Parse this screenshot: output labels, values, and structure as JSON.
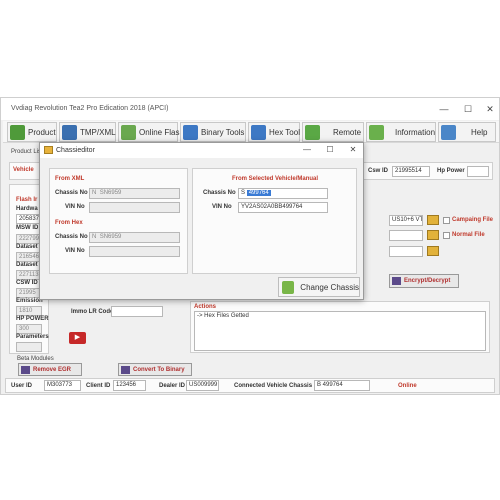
{
  "window": {
    "title": "Vvdiag Revolution Tea2 Pro Edication 2018 (APCI)",
    "minimize_icon": "minimize-icon",
    "maximize_icon": "maximize-icon",
    "close_icon": "close-icon"
  },
  "toolbar": {
    "product": "Product",
    "tmp_xml": "TMP/XML",
    "online_flash": "Online Flash",
    "binary_tools": "Binary Tools",
    "hex_tool": "Hex Tool",
    "remote": "Remote",
    "information": "Information",
    "help": "Help"
  },
  "product_list_label": "Product Lis",
  "vehicle_label": "Vehicle",
  "csw_id": {
    "label": "Csw ID",
    "value": "21995514"
  },
  "hp_power_label": "Hp Power",
  "left_panel": {
    "flash_info": "Flash Ir",
    "hardware_label": "Hardwa",
    "hardware_value": "205837",
    "msw_id_label": "MSW ID",
    "msw_id_value": "222799",
    "dataset_label": "Dataset",
    "dataset_value": "216546",
    "dataset2_label": "Dataset",
    "dataset2_value": "227113",
    "csw_id_label": "CSW ID",
    "csw_id_value": "21995",
    "emission_label": "Emission",
    "emission_value": "1810",
    "hp_power_label": "HP POWER",
    "hp_power_value": "300",
    "parameters_label": "Parameters"
  },
  "right_panel": {
    "vtna_value": "US10+6 VTNA",
    "campaing_file": "Campaing File",
    "normal_file": "Normal File",
    "encrypt_decrypt": "Encrypt/Decrypt"
  },
  "immo_lr_code_label": "Immo LR Code",
  "actions": {
    "title": "Actions",
    "log": "-> Hex Files Getted"
  },
  "beta_modules": {
    "label": "Beta Modules",
    "remove_egr": "Remove EGR",
    "convert_to_binary": "Convert To Binary"
  },
  "status_bar": {
    "user_id_label": "User ID",
    "user_id": "M303773",
    "client_id_label": "Client ID",
    "client_id": "123456",
    "dealer_id_label": "Dealer ID",
    "dealer_id": "US009999",
    "connected_label": "Connected Vehicle Chassis ID",
    "connected_value": "B 499764",
    "status": "Online"
  },
  "dialog": {
    "title": "Chassieditor",
    "from_xml_title": "From XML",
    "xml_chassis_label": "Chassis No",
    "xml_chassis_prefix": "N",
    "xml_chassis_value": "SN6959",
    "xml_vin_label": "VIN No",
    "from_hex_title": "From Hex",
    "hex_chassis_label": "Chassis No",
    "hex_chassis_prefix": "N",
    "hex_chassis_value": "SN6959",
    "hex_vin_label": "VIN No",
    "selected_title": "From Selected Vehicle/Manual",
    "sel_chassis_label": "Chassis No",
    "sel_chassis_prefix": "S",
    "sel_chassis_value": "499764",
    "sel_vin_label": "VIN No",
    "sel_vin_value": "YV2AS02A0BB499764",
    "change_chassis": "Change Chassis"
  },
  "colors": {
    "accent_red": "#c0392b",
    "online": "#c0392b",
    "selection": "#3a7bd5"
  }
}
